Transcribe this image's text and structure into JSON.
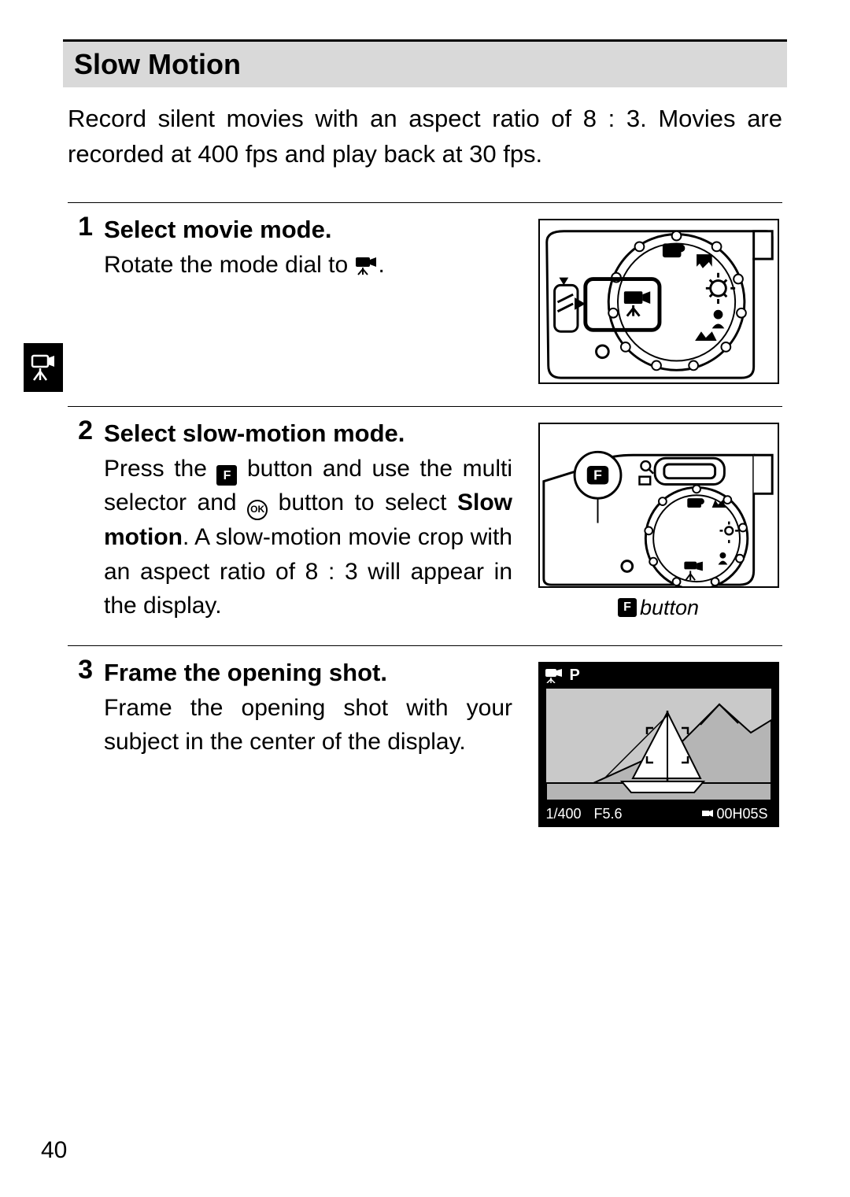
{
  "section_heading": "Slow Motion",
  "intro": "Record silent movies with an aspect ratio of 8 : 3. Movies are recorded at 400 fps and play back at 30 fps.",
  "steps": {
    "s1": {
      "num": "1",
      "title": "Select movie mode.",
      "body_pre": "Rotate the mode dial to ",
      "body_post": "."
    },
    "s2": {
      "num": "2",
      "title": "Select slow-motion mode.",
      "body_pre": "Press the ",
      "body_mid1": " button and use the multi selector and ",
      "body_mid2": " button to select ",
      "bold": "Slow motion",
      "body_post": ". A slow-motion movie crop with an aspect ratio of 8 : 3 will appear in the display.",
      "caption": " button"
    },
    "s3": {
      "num": "3",
      "title": "Frame the opening shot.",
      "body": "Frame the opening shot with your subject in the center of the display."
    }
  },
  "lcd": {
    "mode": "P",
    "shutter": "1/400",
    "aperture": "F5.6",
    "time": "00H05S"
  },
  "icons": {
    "f_button": "F",
    "ok_button": "OK"
  },
  "page_number": "40"
}
